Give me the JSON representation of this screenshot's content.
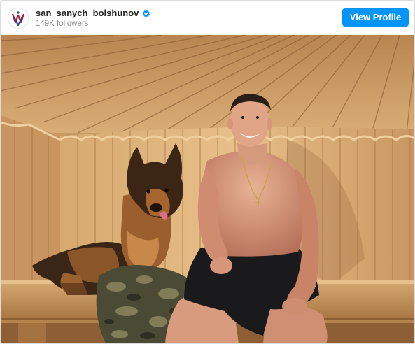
{
  "post": {
    "username": "san_sanych_bolshunov",
    "followers": "149K followers",
    "view_profile_label": "View Profile",
    "verified": true
  },
  "photo": {
    "alt": "Man sitting on sauna bench next to a German Shepherd dog"
  },
  "colors": {
    "button": "#0095f6",
    "verified_badge": "#0095f6",
    "username": "#262626",
    "secondary_text": "#8e8e8e"
  },
  "icons": [
    "avatar-logo",
    "verified-badge-icon"
  ]
}
